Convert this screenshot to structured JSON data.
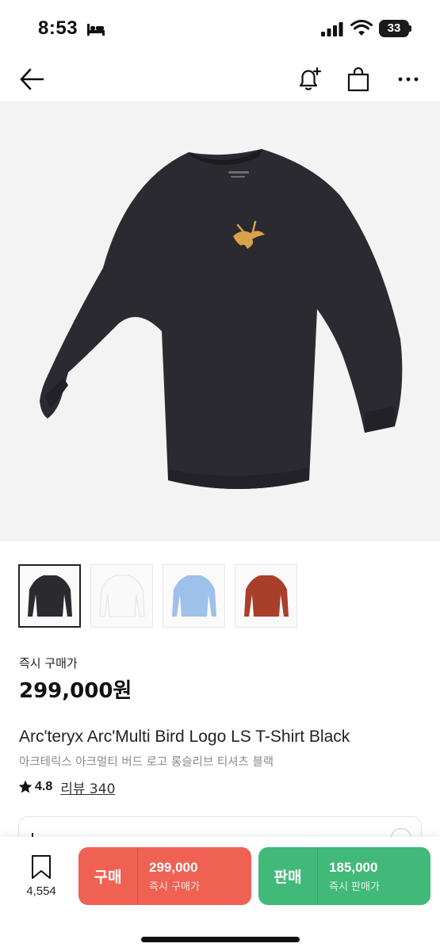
{
  "status_bar": {
    "time": "8:53",
    "battery": "33"
  },
  "nav": {
    "icons": [
      "arrow-left-icon",
      "bell-plus-icon",
      "shopping-bag-icon",
      "more-horizontal-icon"
    ]
  },
  "product": {
    "color_options": [
      {
        "name": "black",
        "color": "#2b2a2f"
      },
      {
        "name": "white",
        "color": "#f6f6f6"
      },
      {
        "name": "light-blue",
        "color": "#9ec1ea"
      },
      {
        "name": "red",
        "color": "#a93e2a"
      }
    ],
    "price_label": "즉시 구매가",
    "price": "299,000원",
    "name_en": "Arc'teryx Arc'Multi Bird Logo LS T-Shirt Black",
    "name_ko": "아크테릭스 아크멀티 버드 로고 롱슬리브 티셔츠 블랙",
    "rating": "4.8",
    "review_text": "리뷰 340"
  },
  "bottom_bar": {
    "wish_count": "4,554",
    "buy": {
      "label": "구매",
      "price": "299,000",
      "sub": "즉시 구매가",
      "color": "#ef6253"
    },
    "sell": {
      "label": "판매",
      "price": "185,000",
      "sub": "즉시 판매가",
      "color": "#41b979"
    }
  }
}
